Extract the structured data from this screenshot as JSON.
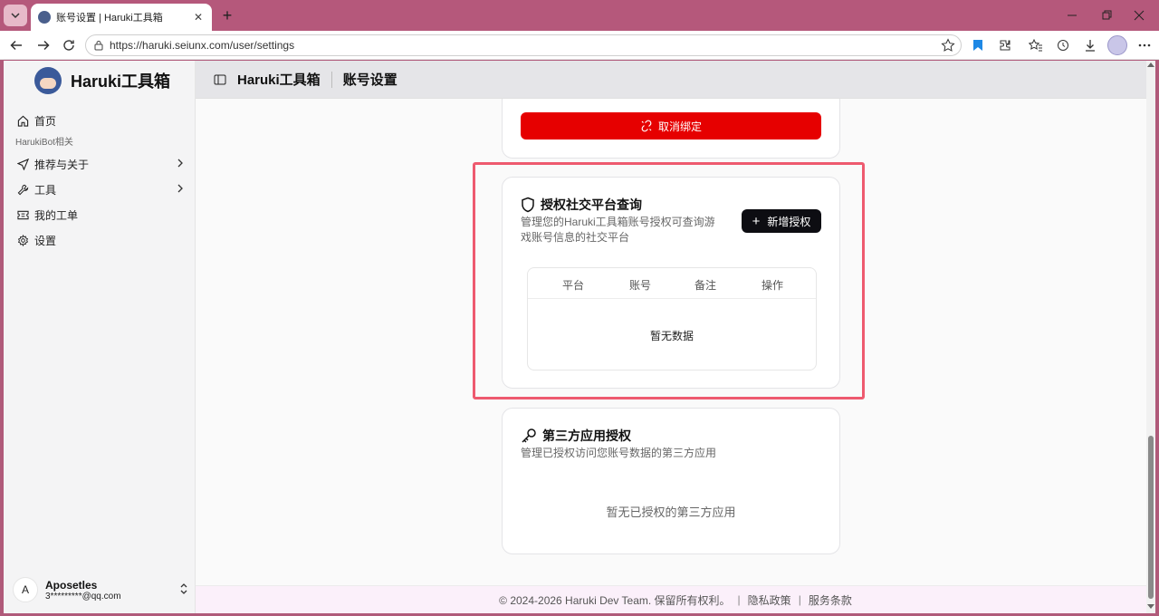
{
  "browser": {
    "tab_title": "账号设置 | Haruki工具箱",
    "tab_close": "✕",
    "new_tab": "+",
    "url": "https://haruki.seiunx.com/user/settings",
    "window_controls": [
      "minimize-icon",
      "restore-icon",
      "close-icon"
    ]
  },
  "sidebar": {
    "brand": "Haruki工具箱",
    "items": [
      {
        "label": "首页",
        "icon": "home-icon"
      },
      {
        "group": "HarukiBot相关"
      },
      {
        "label": "推荐与关于",
        "icon": "send-icon",
        "has_children": true
      },
      {
        "label": "工具",
        "icon": "wrench-icon",
        "has_children": true
      },
      {
        "label": "我的工单",
        "icon": "ticket-icon"
      },
      {
        "label": "设置",
        "icon": "gear-icon"
      }
    ],
    "user": {
      "initial": "A",
      "name": "Aposetles",
      "email": "3*********@qq.com"
    }
  },
  "header": {
    "app_name": "Haruki工具箱",
    "page_title": "账号设置"
  },
  "unbind_card": {
    "button_label": "取消绑定"
  },
  "social_auth_card": {
    "title": "授权社交平台查询",
    "description": "管理您的Haruki工具箱账号授权可查询游戏账号信息的社交平台",
    "add_button": "新增授权",
    "columns": [
      "平台",
      "账号",
      "备注",
      "操作"
    ],
    "empty_text": "暂无数据"
  },
  "third_party_card": {
    "title": "第三方应用授权",
    "description": "管理已授权访问您账号数据的第三方应用",
    "empty_text": "暂无已授权的第三方应用"
  },
  "footer": {
    "copyright": "© 2024-2026 Haruki Dev Team. 保留所有权利。",
    "privacy": "隐私政策",
    "terms": "服务条款",
    "pipe": "|"
  },
  "colors": {
    "danger": "#e60000",
    "primary_dark": "#0d0d12",
    "highlight": "#ee5a6f",
    "tabbar": "#b5587b"
  }
}
